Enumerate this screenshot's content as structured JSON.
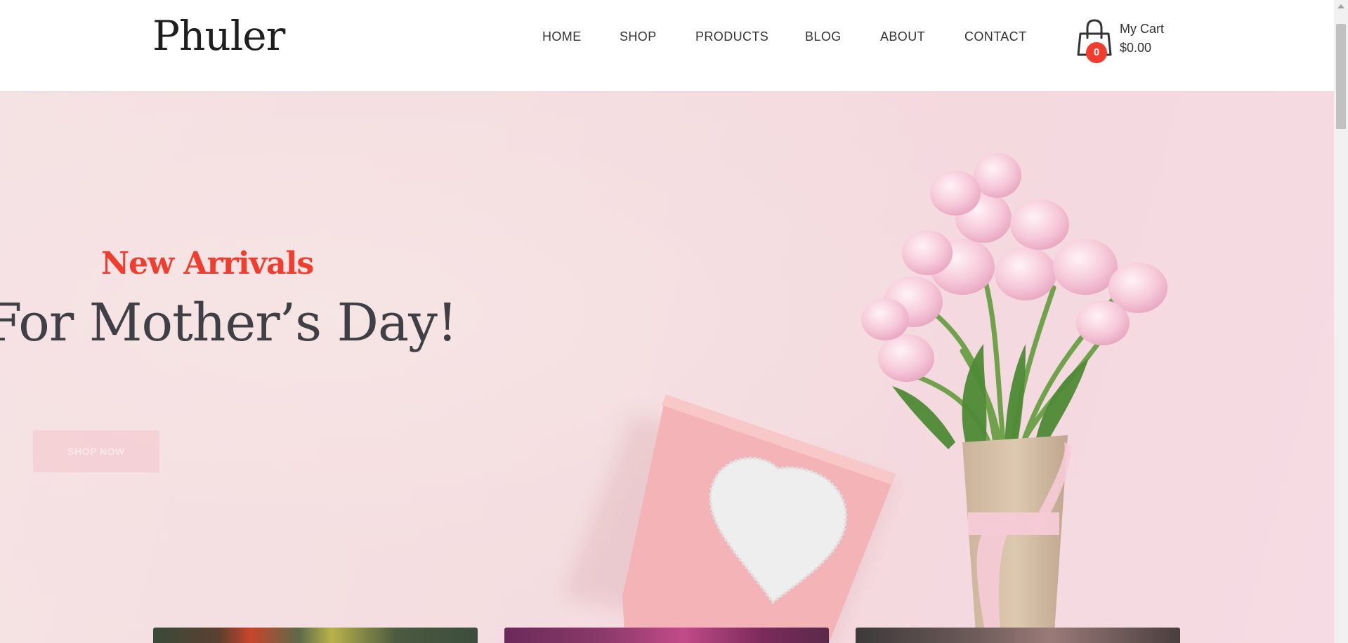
{
  "brand": {
    "logo": "Phuler"
  },
  "nav": {
    "items": [
      {
        "label": "HOME"
      },
      {
        "label": "SHOP"
      },
      {
        "label": "PRODUCTS"
      },
      {
        "label": "BLOG"
      },
      {
        "label": "ABOUT"
      },
      {
        "label": "CONTACT"
      }
    ]
  },
  "cart": {
    "label": "My Cart",
    "total": "$0.00",
    "count": "0",
    "icon": "shopping-bag-icon"
  },
  "hero": {
    "kicker": "New Arrivals",
    "title": "For Mother’s Day!",
    "button_label": "SHOP NOW"
  },
  "colors": {
    "accent": "#f23c2d",
    "title_text": "#3f3f46",
    "hero_background": "#f4dde0"
  }
}
